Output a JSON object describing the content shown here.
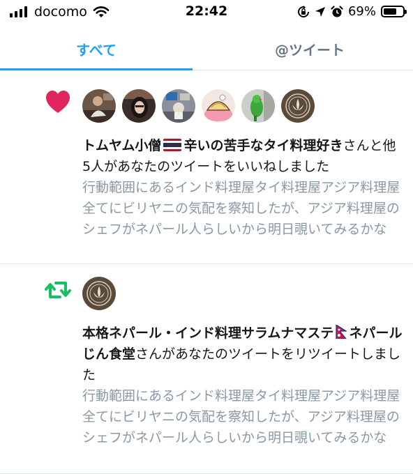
{
  "status_bar": {
    "carrier": "docomo",
    "time": "22:42",
    "battery": "69%",
    "battery_level": 0.69,
    "icons": [
      "signal-bars-icon",
      "wifi-icon",
      "rotation-lock-icon",
      "location-arrow-icon",
      "alarm-icon",
      "battery-icon"
    ]
  },
  "tabs": [
    {
      "label": "すべて",
      "selected": true
    },
    {
      "label": "@ツイート",
      "selected": false
    }
  ],
  "notifications": [
    {
      "type": "like",
      "icon": "heart-icon",
      "icon_color": "#e0245e",
      "avatar_count": 6,
      "actor_name": "トムヤム小僧",
      "actor_flag": "thailand-flag",
      "actor_name_suffix": "辛いの苦手なタイ料理好き",
      "action_text": "さんと他5人があなたのツイートをいいねしました",
      "tweet_text": "行動範囲にあるインド料理屋タイ料理屋アジア料理屋全てにビリヤニの気配を察知したが、アジア料理屋のシェフがネパール人らしいから明日覗いてみるかな"
    },
    {
      "type": "retweet",
      "icon": "retweet-icon",
      "icon_color": "#17bf63",
      "avatar_count": 1,
      "actor_name": "本格ネパール・インド料理サラムナマステ",
      "actor_flag": "nepal-flag",
      "actor_name_suffix": "ネパールじん食堂",
      "action_text": "さんがあなたのツイートをリツイートしました",
      "tweet_text": "行動範囲にあるインド料理屋タイ料理屋アジア料理屋全てにビリヤニの気配を察知したが、アジア料理屋のシェフがネパール人らしいから明日覗いてみるかな"
    }
  ],
  "colors": {
    "accent": "#1da1f2",
    "tab_inactive": "#657786",
    "secondary_text": "#8899a6",
    "divider": "#e1e8ed"
  }
}
